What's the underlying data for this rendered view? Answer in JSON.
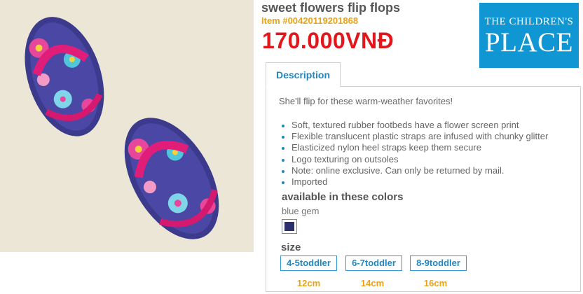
{
  "product": {
    "title": "sweet flowers flip flops",
    "item_number": "Item #00420119201868",
    "price": "170.000VNĐ"
  },
  "brand": {
    "line1": "THE CHILDREN'S",
    "line2": "PLACE",
    "color": "#1096d3"
  },
  "tabs": [
    {
      "label": "Description",
      "active": true
    }
  ],
  "description": {
    "intro": "She'll flip for these warm-weather favorites!",
    "features": [
      "Soft, textured rubber footbeds have a flower screen print",
      "Flexible translucent plastic straps are infused with chunky glitter",
      "Elasticized nylon heel straps keep them secure",
      "Logo texturing on outsoles",
      "Note: online exclusive. Can only be returned by mail.",
      "Imported"
    ]
  },
  "colors": {
    "heading": "available in these colors",
    "selected_name": "blue gem",
    "swatches": [
      {
        "name": "blue gem",
        "hex": "#2a2f6e"
      }
    ]
  },
  "sizes": {
    "heading": "size",
    "options": [
      {
        "label": "4-5toddler",
        "cm": "12cm"
      },
      {
        "label": "6-7toddler",
        "cm": "14cm"
      },
      {
        "label": "8-9toddler",
        "cm": "16cm"
      }
    ]
  },
  "theme": {
    "price_color": "#e3161c",
    "item_color": "#e8a317",
    "link_color": "#1f87c2"
  }
}
